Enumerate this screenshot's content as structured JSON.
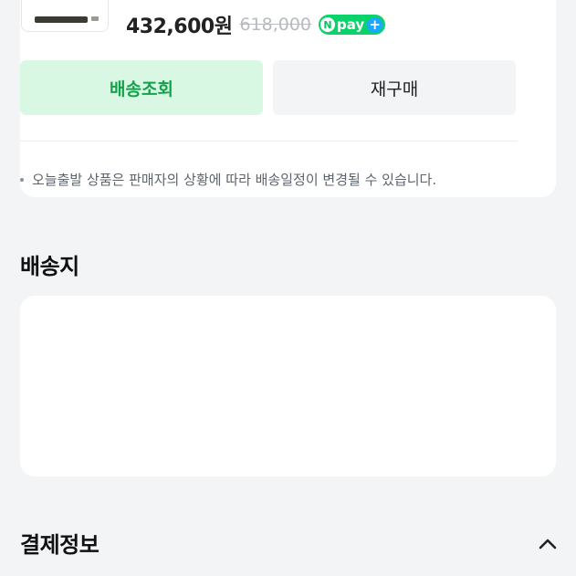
{
  "product": {
    "price": "432,600원",
    "original_price": "618,000",
    "npay_label": "pay",
    "npay_n": "N",
    "npay_plus": "+"
  },
  "actions": {
    "track_label": "배송조회",
    "rebuy_label": "재구매"
  },
  "notice": "오늘출발 상품은 판매자의 상황에 따라 배송일정이 변경될 수 있습니다.",
  "sections": {
    "shipping_title": "배송지",
    "payment_title": "결제정보"
  },
  "icons": {
    "bullet": "dot-icon",
    "collapse": "chevron-up-icon"
  },
  "colors": {
    "accent_green": "#13a24b",
    "accent_green_bg": "#d8f8e3",
    "npay_green": "#09d36a",
    "npay_blue": "#1aa8ff",
    "page_bg": "#f2f4f6"
  }
}
